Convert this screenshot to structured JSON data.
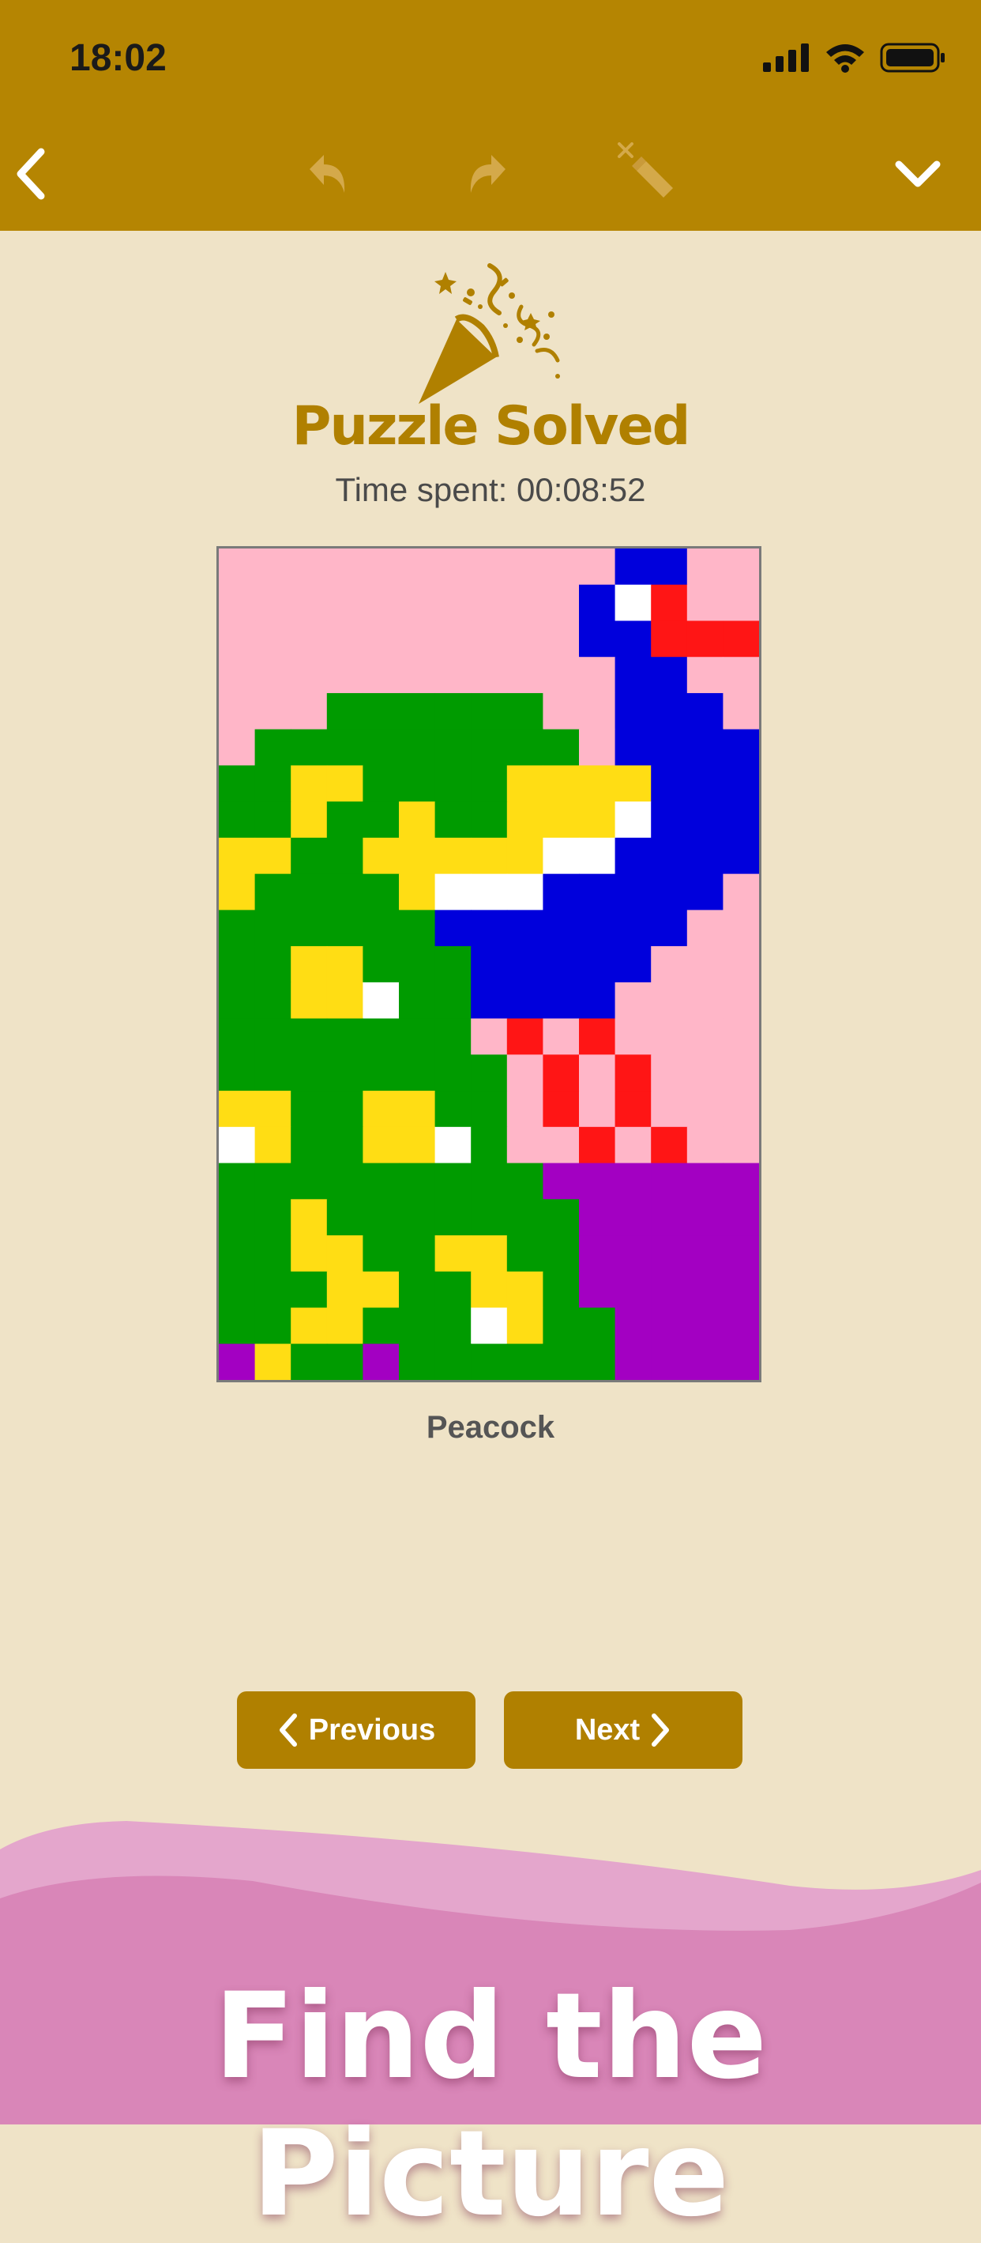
{
  "status_bar": {
    "time": "18:02",
    "icons": [
      "signal-icon",
      "wifi-icon",
      "battery-icon"
    ]
  },
  "toolbar": {
    "icons": [
      "back-icon",
      "undo-icon",
      "redo-icon",
      "clear-icon",
      "collapse-icon"
    ],
    "color": "#B58502",
    "disabled_icon_color": "#D4A94A"
  },
  "result": {
    "title": "Puzzle Solved",
    "time_spent": "Time spent: 00:08:52",
    "picture_name": "Peacock",
    "icon": "party-popper-icon"
  },
  "puzzle": {
    "columns": 15,
    "rows": 23,
    "palette": {
      "P": "#FFB6C8",
      "B": "#0000DC",
      "W": "#FFFFFF",
      "R": "#FF1515",
      "G": "#009B00",
      "Y": "#FFDD14",
      "V": "#A300C2"
    },
    "grid": [
      "PPPPPPPPPPPBBPP",
      "PPPPPPPPPPBWRPP",
      "PPPPPPPPPPBBRRR",
      "PPPPPPPPPPPBBPP",
      "PPPGGGGGGPPBBBP",
      "PGGGGGGGGGPBBBB",
      "GGYYGGGGYYYYBBB",
      "GGYGGYGGYYYWBBB",
      "YYGGYYYYYWWBBBB",
      "YGGGGYWWWBBBBBP",
      "GGGGGGBBBBBBBPP",
      "GGYYGGGBBBBBPPP",
      "GGYYWGGBBBBPPPP",
      "GGGGGGGPRPRPPPP",
      "GGGGGGGGPRPRPPP",
      "YYGGYYGGPRPRPPP",
      "WYGGYYWGPPRPRPP",
      "GGGGGGGGGVVVVVV",
      "GGYGGGGGGGVVVVV",
      "GGYYGGYYGGVVVVV",
      "GGGYYGGYYGVVVVV",
      "GGYYGGGWYGGVVVV",
      "VYGGVGGGGGGVVVV"
    ]
  },
  "buttons": {
    "previous": "Previous",
    "next": "Next"
  },
  "banner": {
    "text": "Find the Picture",
    "colors": {
      "light_wave": "#E4A6CC",
      "dark_wave": "#D986B8"
    }
  }
}
